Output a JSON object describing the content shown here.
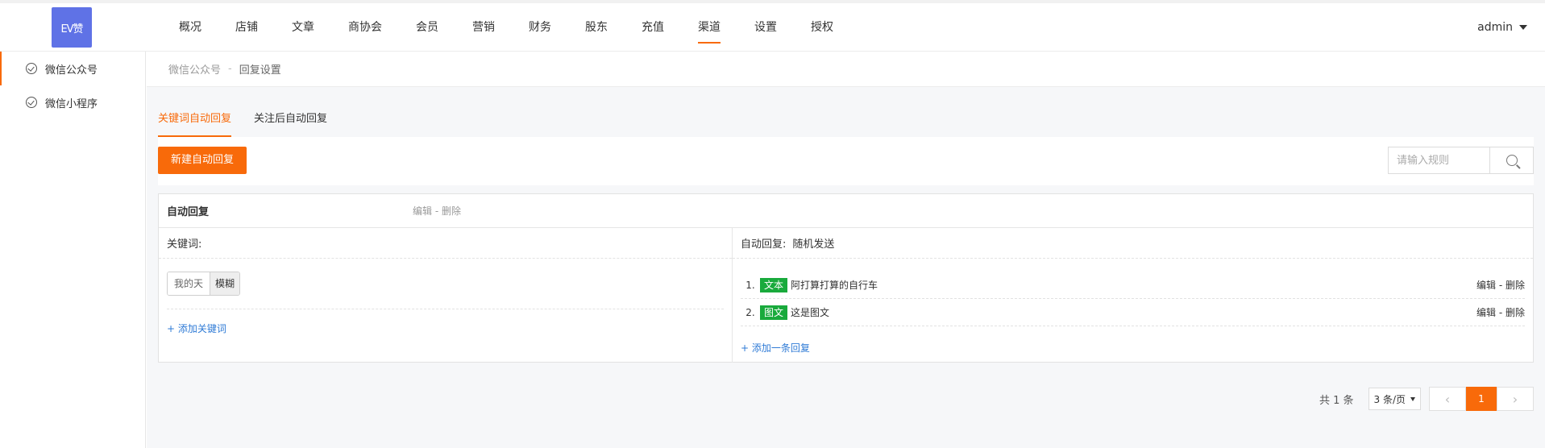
{
  "header": {
    "logo_text": "EV赞",
    "nav": [
      {
        "label": "概况"
      },
      {
        "label": "店铺"
      },
      {
        "label": "文章"
      },
      {
        "label": "商协会"
      },
      {
        "label": "会员"
      },
      {
        "label": "营销"
      },
      {
        "label": "财务"
      },
      {
        "label": "股东"
      },
      {
        "label": "充值"
      },
      {
        "label": "渠道",
        "active": true
      },
      {
        "label": "设置"
      },
      {
        "label": "授权"
      }
    ],
    "user": "admin"
  },
  "sidebar": {
    "items": [
      {
        "label": "微信公众号",
        "active": true
      },
      {
        "label": "微信小程序"
      }
    ]
  },
  "breadcrumb": {
    "items": [
      "微信公众号",
      "回复设置"
    ],
    "separator": "-"
  },
  "tabs": [
    {
      "label": "关键词自动回复",
      "active": true
    },
    {
      "label": "关注后自动回复"
    }
  ],
  "toolbar": {
    "new_button": "新建自动回复",
    "search_placeholder": "请输入规则"
  },
  "rule": {
    "title": "自动回复",
    "edit": "编辑",
    "delete": "删除",
    "action_sep": "-",
    "keywords_label": "关键词:",
    "keyword": {
      "text": "我的天",
      "mode": "模糊"
    },
    "add_keyword": "+ 添加关键词",
    "reply_label": "自动回复:",
    "reply_mode": "随机发送",
    "replies": [
      {
        "num": "1.",
        "type": "文本",
        "content": "阿打算打算的自行车"
      },
      {
        "num": "2.",
        "type": "图文",
        "content": "这是图文"
      }
    ],
    "add_reply": "+ 添加一条回复"
  },
  "pagination": {
    "total": "共 1 条",
    "page_size": "3 条/页",
    "current": "1",
    "prev": "‹",
    "next": "›"
  },
  "colors": {
    "accent": "#f86a0a",
    "tag_green": "#19aa3c",
    "link_blue": "#2f7bd6",
    "logo_bg": "#5f72e6"
  }
}
